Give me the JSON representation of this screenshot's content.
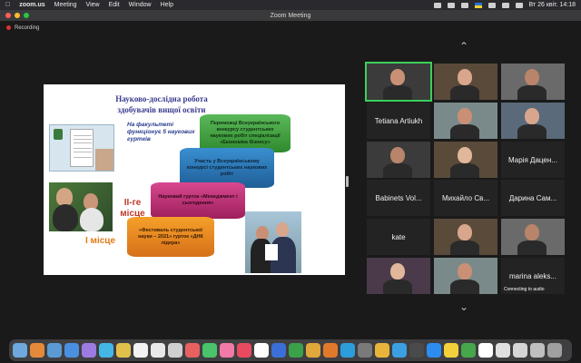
{
  "menubar": {
    "app_name": "zoom.us",
    "items": [
      "Meeting",
      "View",
      "Edit",
      "Window",
      "Help"
    ],
    "clock": "Вт 26 квіт. 14:18"
  },
  "window": {
    "title": "Zoom Meeting",
    "recording_label": "Recording"
  },
  "slide": {
    "title": "Науково-дослідна робота здобувачів вищої освіти",
    "faculty_note": "На факультеті функціонує 5 наукових гуртків",
    "place_second": "II-ге місце",
    "place_first": "I місце",
    "steps": [
      "Переможці Всеукраїнського конкурсу студентських наукових робіт спеціалізації «Економіка бізнесу»",
      "Участь у Всеукраїнському конкурсі студентських наукових робіт",
      "Науковий гурток «Менеджмент і сьогодення»",
      "«Фестиваль студентської науки – 2021» гурток «ДНК лідера»"
    ],
    "step_colors": [
      "#4caf50",
      "#2f7fc0",
      "#c8307a",
      "#ef8a1f"
    ]
  },
  "participants": [
    {
      "name": "",
      "video": true,
      "active": true
    },
    {
      "name": "",
      "video": true
    },
    {
      "name": "",
      "video": true
    },
    {
      "name": "Tetiana Artiukh",
      "video": false
    },
    {
      "name": "",
      "video": true
    },
    {
      "name": "",
      "video": true
    },
    {
      "name": "",
      "video": true
    },
    {
      "name": "",
      "video": true
    },
    {
      "name": "Марія Дацен...",
      "video": false
    },
    {
      "name": "Babinets Vol...",
      "video": false
    },
    {
      "name": "Михайло Св...",
      "video": false
    },
    {
      "name": "Дарина Сам...",
      "video": false
    },
    {
      "name": "kate",
      "video": false
    },
    {
      "name": "",
      "video": true
    },
    {
      "name": "",
      "video": true
    },
    {
      "name": "",
      "video": true
    },
    {
      "name": "",
      "video": true
    },
    {
      "name": "marina aleks...",
      "video": false,
      "caption": "Connecting to audio"
    }
  ],
  "dock": {
    "colors": [
      "#6fa8dc",
      "#e58a3a",
      "#5a9bd5",
      "#4a8fe0",
      "#9c7be0",
      "#43b7e6",
      "#e0c04a",
      "#f2f2f2",
      "#e8e8e8",
      "#d0d0d0",
      "#e86060",
      "#4ac36a",
      "#f27aa8",
      "#e84a5f",
      "#ffffff",
      "#3a6fd8",
      "#3aa04a",
      "#e0a73a",
      "#e07a2a",
      "#2d9cdb",
      "#7a7a7a",
      "#e8b53a",
      "#3aa0e0",
      "#4a4a4a",
      "#2d8cf0",
      "#f2d13a",
      "#46a74a",
      "#ffffff",
      "#e0e0e0",
      "#d6d6d6",
      "#bfbfbf",
      "#a0a0a0"
    ]
  }
}
